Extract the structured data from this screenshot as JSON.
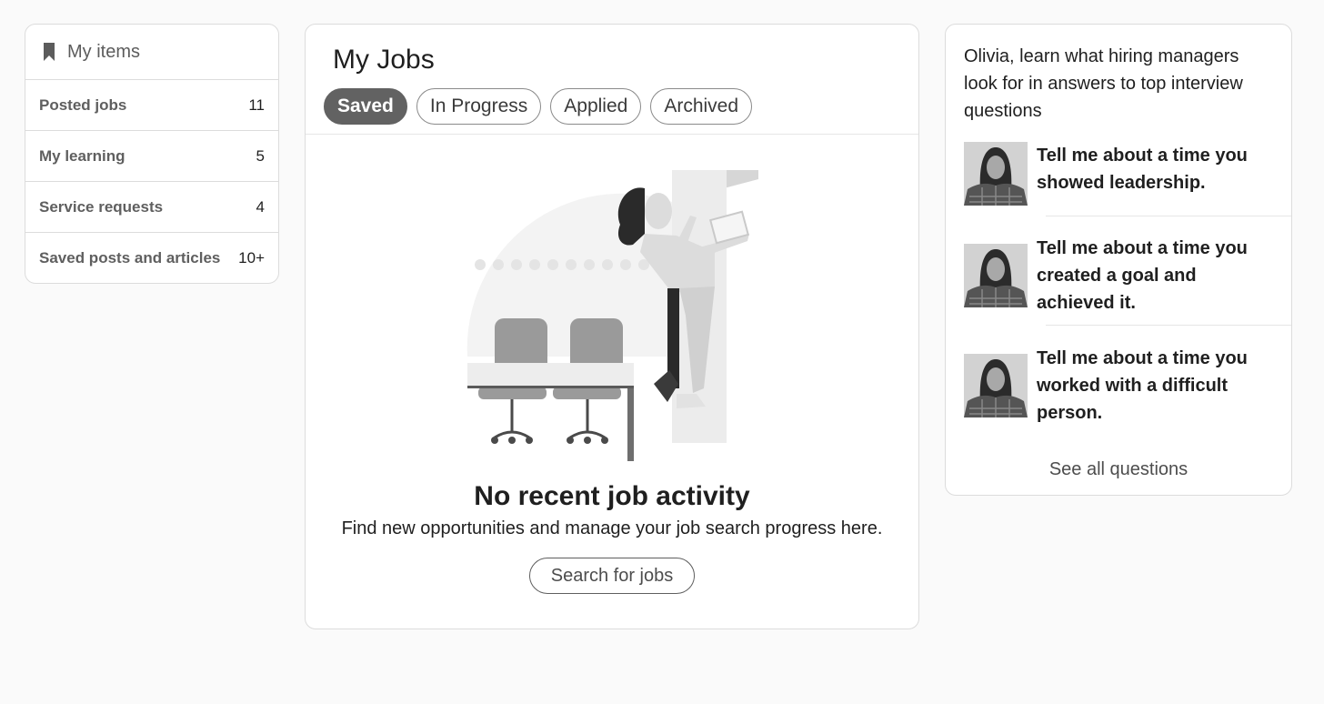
{
  "sidebar": {
    "title": "My items",
    "icon": "bookmark-icon",
    "items": [
      {
        "label": "Posted jobs",
        "count": "11"
      },
      {
        "label": "My learning",
        "count": "5"
      },
      {
        "label": "Service requests",
        "count": "4"
      },
      {
        "label": "Saved posts and articles",
        "count": "10+"
      }
    ]
  },
  "jobs": {
    "title": "My Jobs",
    "tabs": [
      {
        "label": "Saved",
        "active": true
      },
      {
        "label": "In Progress",
        "active": false
      },
      {
        "label": "Applied",
        "active": false
      },
      {
        "label": "Archived",
        "active": false
      }
    ],
    "empty_title": "No recent job activity",
    "empty_subtitle": "Find new opportunities and manage your job search progress here.",
    "search_button": "Search for jobs"
  },
  "interview": {
    "intro": "Olivia, learn what hiring managers look for in answers to top interview questions",
    "questions": [
      {
        "text": "Tell me about a time you showed leadership."
      },
      {
        "text": "Tell me about a time you created a goal and achieved it."
      },
      {
        "text": "Tell me about a time you worked with a difficult person."
      }
    ],
    "see_all": "See all questions"
  },
  "colors": {
    "page_bg": "#fafafa",
    "active_tab": "#626262",
    "border": "#dcdcdc"
  }
}
